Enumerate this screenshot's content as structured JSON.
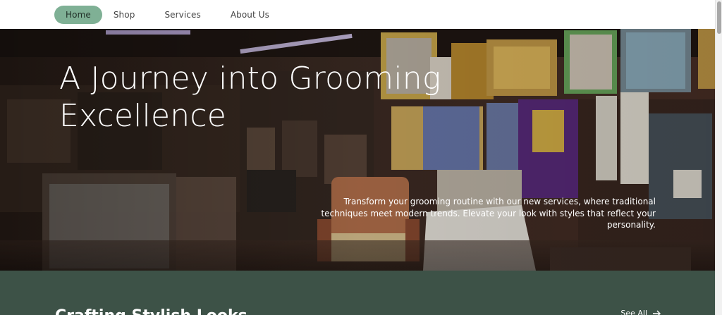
{
  "nav": {
    "items": [
      {
        "label": "Home",
        "active": true
      },
      {
        "label": "Shop"
      },
      {
        "label": "Services"
      },
      {
        "label": "About Us"
      }
    ]
  },
  "hero": {
    "title": "A Journey into Grooming Excellence",
    "description": "Transform your grooming routine with our new services, where traditional techniques meet modern trends. Elevate your look with styles that reflect your personality."
  },
  "section": {
    "title": "Crafting Stylish Looks",
    "see_all_label": "See All"
  },
  "colors": {
    "accent": "#7fb095",
    "section_bg": "#3d5247"
  }
}
